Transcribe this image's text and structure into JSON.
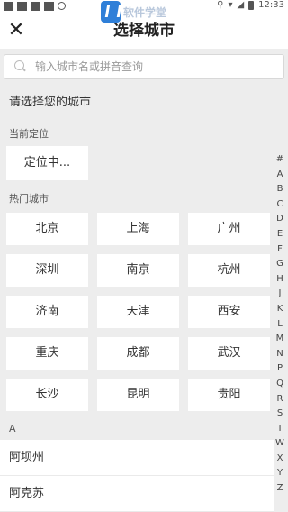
{
  "status_bar": {
    "time": "12:33",
    "icons": [
      "notification-icon",
      "notification-icon",
      "notification-icon",
      "notification-icon",
      "sync-icon"
    ],
    "right_icons": [
      "location-icon",
      "wifi-icon",
      "signal-icon",
      "battery-icon"
    ]
  },
  "watermark": {
    "text": "软件学堂"
  },
  "header": {
    "title": "选择城市",
    "close_icon": "close-icon"
  },
  "search": {
    "placeholder": "输入城市名或拼音查询",
    "value": ""
  },
  "prompt": "请选择您的城市",
  "current": {
    "label": "当前定位",
    "value": "定位中..."
  },
  "hot": {
    "label": "热门城市",
    "cities": [
      "北京",
      "上海",
      "广州",
      "深圳",
      "南京",
      "杭州",
      "济南",
      "天津",
      "西安",
      "重庆",
      "成都",
      "武汉",
      "长沙",
      "昆明",
      "贵阳"
    ]
  },
  "groups": [
    {
      "letter": "A",
      "cities": [
        "阿坝州",
        "阿克苏"
      ]
    }
  ],
  "index": [
    "#",
    "A",
    "B",
    "C",
    "D",
    "E",
    "F",
    "G",
    "H",
    "J",
    "K",
    "L",
    "M",
    "N",
    "P",
    "Q",
    "R",
    "S",
    "T",
    "W",
    "X",
    "Y",
    "Z"
  ]
}
